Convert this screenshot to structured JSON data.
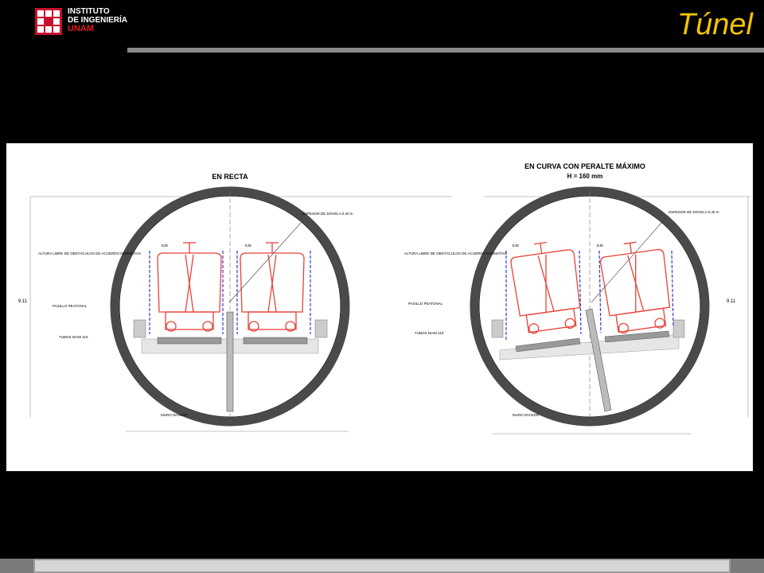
{
  "header": {
    "logo_line1": "INSTITUTO",
    "logo_line2": "DE INGENIERÍA",
    "logo_line3": "UNAM",
    "title": "Túnel"
  },
  "diagram": {
    "left": {
      "title": "EN RECTA",
      "dim_height": "9.11",
      "labels": {
        "clearance": "ALTURA LIBRE DE OBSTÁCULOS DE ACUERDO NORMATIVA",
        "walkway": "PASILLO PEATONAL",
        "pipes": "TUBOS DIAM 110",
        "wall": "MURO DIVISOR",
        "segment": "ESPESOR DE DOVELA 0.40 m",
        "axis_l": "EJE",
        "axis_r": "EJE"
      }
    },
    "right": {
      "title": "EN CURVA CON PERALTE MÁXIMO",
      "subtitle": "H = 160 mm",
      "dim_height": "9.11",
      "labels": {
        "clearance": "ALTURA LIBRE DE OBSTÁCULOS DE ACUERDO NORMATIVA",
        "walkway": "PASILLO PEATONAL",
        "pipes": "TUBOS DIAM 110",
        "wall": "MURO DIVISOR",
        "segment": "ESPESOR DE DOVELA 0.40 m",
        "axis_l": "EJE",
        "axis_r": "EJE"
      }
    }
  },
  "colors": {
    "title": "#f5c400",
    "train": "#e8423a",
    "clearance": "#2f3bd6",
    "ring": "#4a4a4a"
  }
}
